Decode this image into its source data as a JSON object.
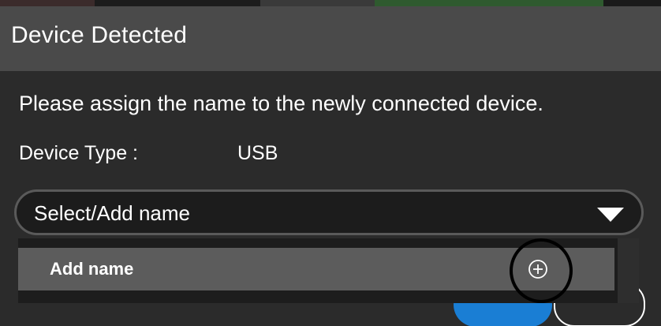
{
  "dialog": {
    "title": "Device Detected",
    "message": "Please assign the name to the newly connected device.",
    "device_type_label": "Device Type :",
    "device_type_value": "USB"
  },
  "name_select": {
    "selected_value": "Select/Add name",
    "icon": "chevron-down-icon"
  },
  "dropdown": {
    "items": [
      {
        "label": "Add name",
        "icon": "plus-circle-icon"
      }
    ]
  },
  "colors": {
    "header_bg": "#4a4a4a",
    "dialog_bg": "#2b2b2b",
    "primary_button": "#1a7ed4",
    "highlight_item": "#5c5c5c"
  }
}
